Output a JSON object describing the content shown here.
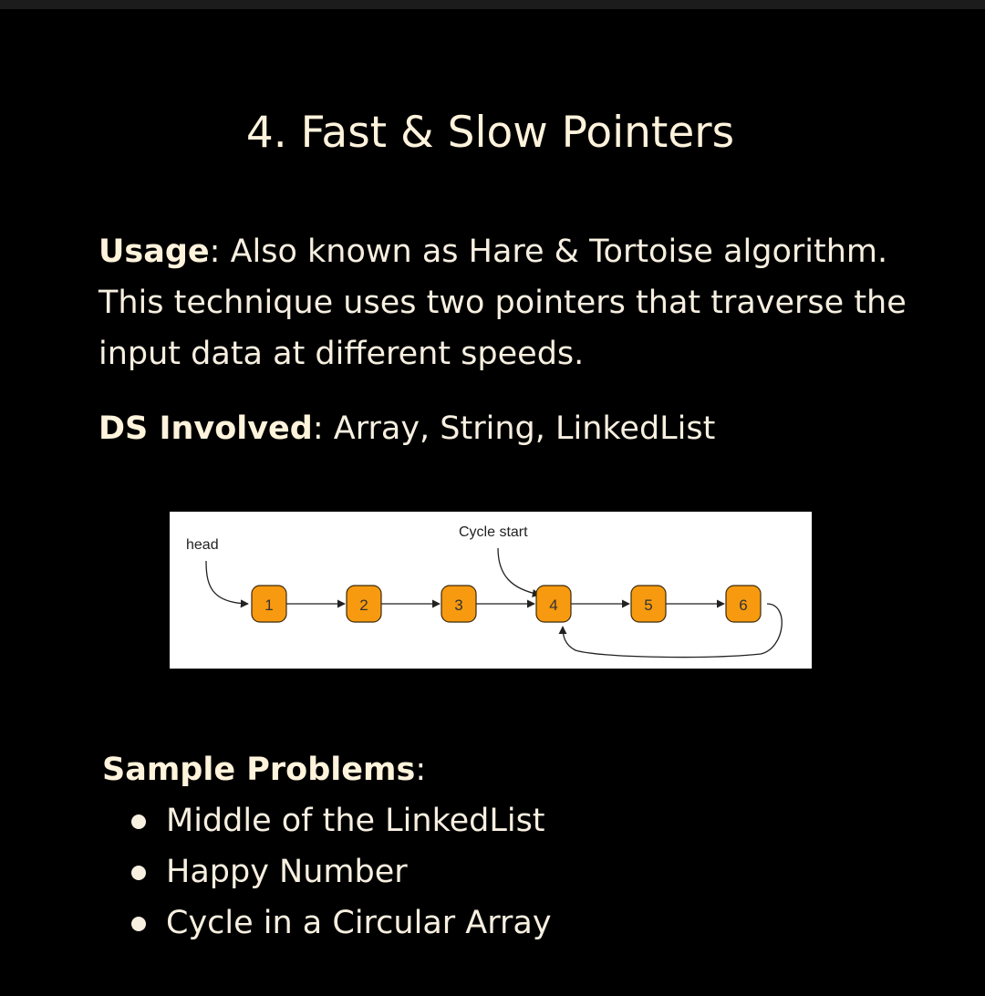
{
  "title": "4. Fast & Slow Pointers",
  "usage": {
    "label": "Usage",
    "text": ": Also known as Hare & Tortoise algorithm. This technique uses two pointers that traverse the input data at different speeds."
  },
  "ds": {
    "label": "DS Involved",
    "text": ": Array, String, LinkedList"
  },
  "diagram": {
    "head_label": "head",
    "cycle_label": "Cycle start",
    "nodes": [
      "1",
      "2",
      "3",
      "4",
      "5",
      "6"
    ],
    "node_color": "#f79a0f"
  },
  "sample": {
    "label": "Sample Problems",
    "colon": ":",
    "items": [
      "Middle of the LinkedList",
      "Happy Number",
      "Cycle in a Circular Array"
    ]
  }
}
